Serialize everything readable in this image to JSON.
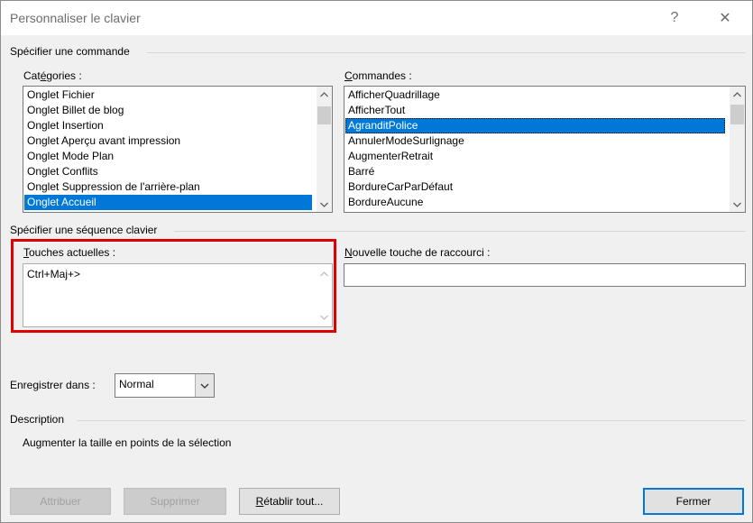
{
  "window": {
    "title": "Personnaliser le clavier",
    "help_glyph": "?",
    "close_glyph": "✕"
  },
  "section_command": {
    "legend": "Spécifier une commande",
    "categories_label_pre": "Cat",
    "categories_label_u": "é",
    "categories_label_post": "gories :",
    "commands_label_u": "C",
    "commands_label_post": "ommandes :",
    "categories": [
      "Onglet Fichier",
      "Onglet Billet de blog",
      "Onglet Insertion",
      "Onglet Aperçu avant impression",
      "Onglet Mode Plan",
      "Onglet Conflits",
      "Onglet Suppression de l'arrière-plan",
      "Onglet Accueil"
    ],
    "categories_selected": 7,
    "commands": [
      "AfficherQuadrillage",
      "AfficherTout",
      "AgranditPolice",
      "AnnulerModeSurlignage",
      "AugmenterRetrait",
      "Barré",
      "BordureCarParDéfaut",
      "BordureAucune"
    ],
    "commands_selected": 2
  },
  "section_keys": {
    "legend": "Spécifier une séquence clavier",
    "current_label_u": "T",
    "current_label_post": "ouches actuelles :",
    "current_value": "Ctrl+Maj+>",
    "new_label_u": "N",
    "new_label_post": "ouvelle touche de raccourci :",
    "new_value": ""
  },
  "save_in": {
    "label_pre": "Enre",
    "label_u": "g",
    "label_post": "istrer dans :",
    "value": "Normal"
  },
  "description": {
    "legend": "Description",
    "text": "Augmenter la taille en points de la sélection"
  },
  "buttons": {
    "assign": "Attribuer",
    "remove": "Supprimer",
    "reset_u": "R",
    "reset_post": "établir tout...",
    "close": "Fermer"
  },
  "colors": {
    "selection": "#0078d7",
    "highlight_box": "#e00000"
  }
}
